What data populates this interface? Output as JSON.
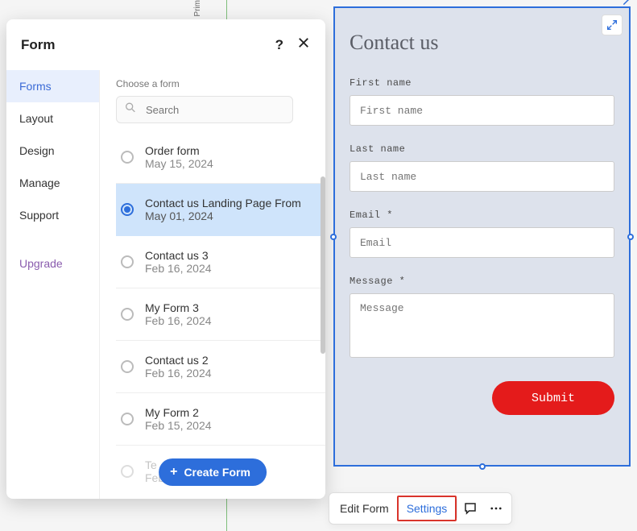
{
  "rotated_label": "Prim",
  "panel": {
    "title": "Form",
    "choose_label": "Choose a form",
    "search_placeholder": "Search",
    "create_button": "Create Form"
  },
  "sidebar": {
    "items": [
      {
        "label": "Forms",
        "key": "forms"
      },
      {
        "label": "Layout",
        "key": "layout"
      },
      {
        "label": "Design",
        "key": "design"
      },
      {
        "label": "Manage",
        "key": "manage"
      },
      {
        "label": "Support",
        "key": "support"
      }
    ],
    "upgrade": "Upgrade"
  },
  "forms": [
    {
      "name": "Order form",
      "date": "May 15, 2024"
    },
    {
      "name": "Contact us Landing Page From",
      "date": "May 01, 2024"
    },
    {
      "name": "Contact us 3",
      "date": "Feb 16, 2024"
    },
    {
      "name": "My Form 3",
      "date": "Feb 16, 2024"
    },
    {
      "name": "Contact us 2",
      "date": "Feb 16, 2024"
    },
    {
      "name": "My Form 2",
      "date": "Feb 15, 2024"
    },
    {
      "name": "Te",
      "date": "Feb 14, 2024"
    }
  ],
  "preview": {
    "title": "Contact us",
    "fields": {
      "first_name": {
        "label": "First name",
        "placeholder": "First name"
      },
      "last_name": {
        "label": "Last name",
        "placeholder": "Last name"
      },
      "email": {
        "label": "Email *",
        "placeholder": "Email"
      },
      "message": {
        "label": "Message *",
        "placeholder": "Message"
      }
    },
    "submit": "Submit"
  },
  "toolbar": {
    "edit_form": "Edit Form",
    "settings": "Settings"
  }
}
